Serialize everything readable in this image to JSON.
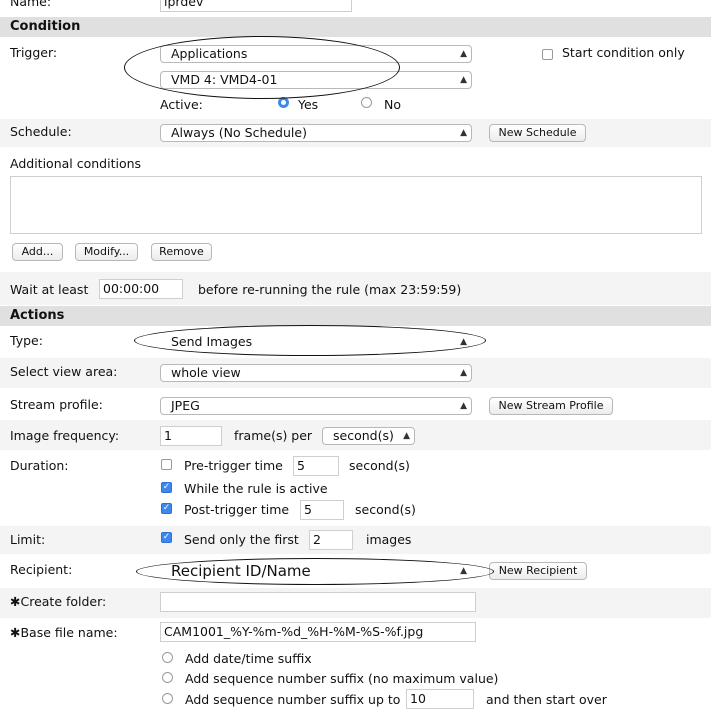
{
  "name": {
    "label": "Name:",
    "value": "lprdev"
  },
  "condition": {
    "header": "Condition",
    "trigger_label": "Trigger:",
    "trigger_value": "Applications",
    "trigger_sub_value": "VMD 4: VMD4-01",
    "start_condition_only": "Start condition only",
    "active_label": "Active:",
    "yes": "Yes",
    "no": "No",
    "schedule_label": "Schedule:",
    "schedule_value": "Always (No Schedule)",
    "new_schedule": "New Schedule",
    "additional_label": "Additional conditions",
    "add": "Add...",
    "modify": "Modify...",
    "remove": "Remove",
    "wait_label": "Wait at least",
    "wait_value": "00:00:00",
    "wait_suffix": "before re-running the rule (max 23:59:59)"
  },
  "actions": {
    "header": "Actions",
    "type_label": "Type:",
    "type_value": "Send Images",
    "view_label": "Select view area:",
    "view_value": "whole view",
    "stream_label": "Stream profile:",
    "stream_value": "JPEG",
    "new_stream": "New Stream Profile",
    "freq_label": "Image frequency:",
    "freq_value": "1",
    "freq_mid": "frame(s) per",
    "freq_unit": "second(s)",
    "duration_label": "Duration:",
    "pre_trigger": "Pre-trigger time",
    "pre_value": "5",
    "seconds": "second(s)",
    "while_active": "While the rule is active",
    "post_trigger": "Post-trigger time",
    "post_value": "5",
    "limit_label": "Limit:",
    "send_only": "Send only the first",
    "limit_value": "2",
    "images": "images",
    "recipient_label": "Recipient:",
    "recipient_value": "Recipient ID/Name",
    "new_recipient": "New Recipient",
    "create_folder_label": "✱Create folder:",
    "create_folder_value": "",
    "base_file_label": "✱Base file name:",
    "base_file_value": "CAM1001_%Y-%m-%d_%H-%M-%S-%f.jpg",
    "suffix_datetime": "Add date/time suffix",
    "suffix_sequence": "Add sequence number suffix (no maximum value)",
    "suffix_sequence_upto": "Add sequence number suffix up to",
    "suffix_upto_value": "10",
    "suffix_then": "and then start over"
  }
}
